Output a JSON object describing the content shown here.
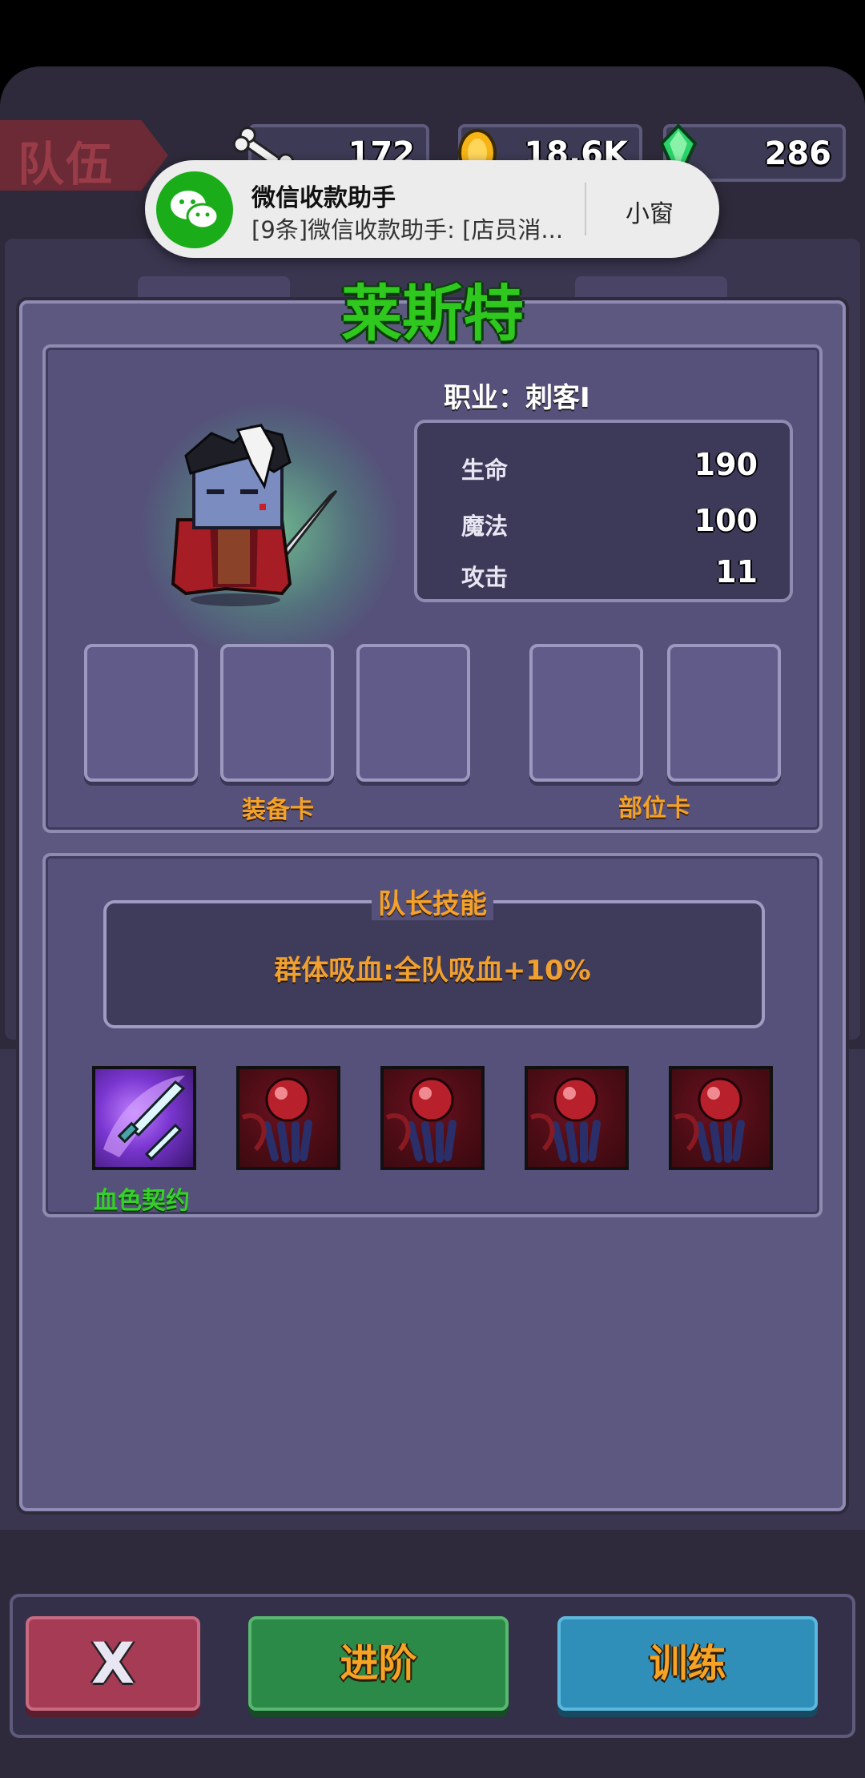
{
  "top_bar": {
    "tab_label": "队伍",
    "resources": [
      {
        "icon": "bone-icon",
        "value": "172"
      },
      {
        "icon": "gold-coin-icon",
        "value": "18.6K"
      },
      {
        "icon": "green-gem-icon",
        "value": "286"
      }
    ]
  },
  "notification": {
    "app": "微信收款助手",
    "message": "[9条]微信收款助手: [店员消...",
    "action": "小窗"
  },
  "character": {
    "name": "莱斯特",
    "class_label": "职业：刺客Ⅰ",
    "stats": [
      {
        "label": "生命",
        "value": "190"
      },
      {
        "label": "魔法",
        "value": "100"
      },
      {
        "label": "攻击",
        "value": "11"
      }
    ],
    "equipment_label": "装备卡",
    "part_label": "部位卡"
  },
  "leader_skill": {
    "title": "队长技能",
    "description": "群体吸血:全队吸血+10%"
  },
  "skills": {
    "first_skill_name": "血色契约",
    "icons": [
      "crystal-blade-icon",
      "blood-orb-icon",
      "blood-orb-icon",
      "blood-orb-icon",
      "blood-orb-icon"
    ]
  },
  "buttons": {
    "close": "X",
    "advance": "进阶",
    "train": "训练"
  },
  "colors": {
    "name_green": "#2fc81e",
    "label_orange": "#f4a12a",
    "close_red": "#a53b55",
    "advance_green": "#2c8a48",
    "train_blue": "#2f8fb8"
  }
}
